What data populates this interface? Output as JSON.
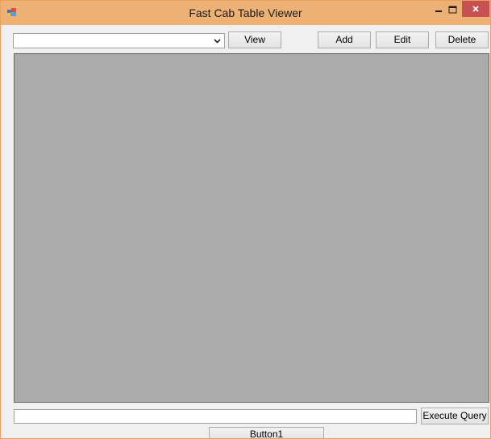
{
  "window": {
    "title": "Fast Cab Table Viewer",
    "titlebar_color": "#eeb175",
    "close_color": "#c75050",
    "app_icon": "window-app-icon"
  },
  "toolbar": {
    "table_select": {
      "selected_value": "",
      "icon": "chevron-down-icon"
    },
    "view_label": "View",
    "add_label": "Add",
    "edit_label": "Edit",
    "delete_label": "Delete"
  },
  "grid": {
    "background": "#ababab",
    "rows": []
  },
  "query": {
    "value": "",
    "execute_label": "Execute Query"
  },
  "footer": {
    "button1_label": "Button1"
  }
}
